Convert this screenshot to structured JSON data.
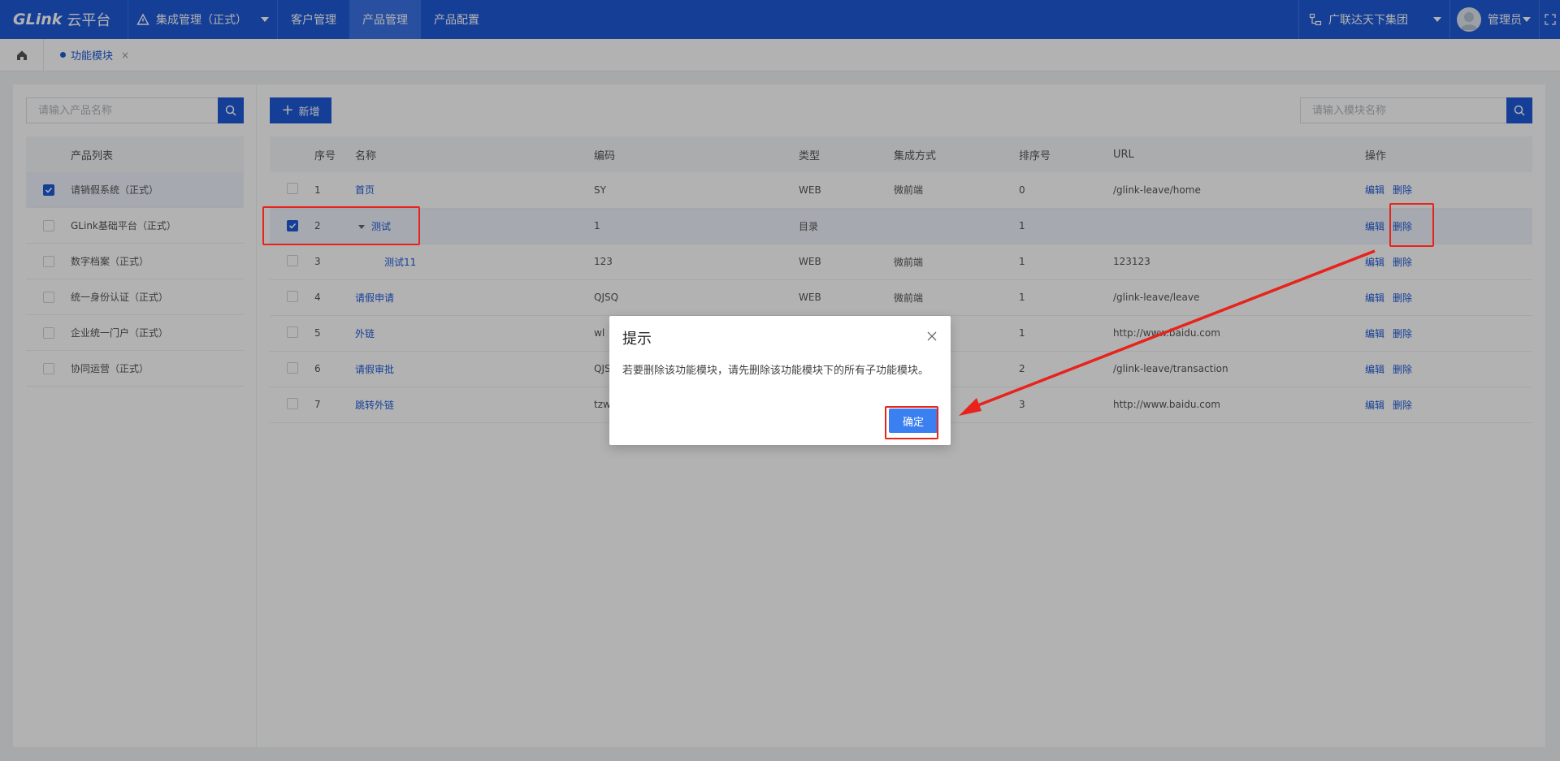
{
  "topbar": {
    "logo": "GLink",
    "logo_cn": "云平台",
    "system_select": "集成管理（正式）",
    "nav": [
      "客户管理",
      "产品管理",
      "产品配置"
    ],
    "active_nav": "产品管理",
    "org": "广联达天下集团",
    "user": "管理员"
  },
  "tabs": {
    "active_tab": "功能模块",
    "close": "×"
  },
  "left": {
    "search_placeholder": "请输入产品名称",
    "list_header": "产品列表",
    "products": [
      {
        "name": "请销假系统（正式）",
        "selected": true
      },
      {
        "name": "GLink基础平台（正式）",
        "selected": false
      },
      {
        "name": "数字档案（正式）",
        "selected": false
      },
      {
        "name": "统一身份认证（正式）",
        "selected": false
      },
      {
        "name": "企业统一门户（正式）",
        "selected": false
      },
      {
        "name": "协同运营（正式）",
        "selected": false
      }
    ]
  },
  "right": {
    "add_label": "新增",
    "search_placeholder": "请输入模块名称",
    "columns": [
      "序号",
      "名称",
      "编码",
      "类型",
      "集成方式",
      "排序号",
      "URL",
      "操作"
    ],
    "rows": [
      {
        "no": "1",
        "name": "首页",
        "code": "SY",
        "type": "WEB",
        "mode": "微前端",
        "order": "0",
        "url": "/glink-leave/home",
        "checked": false
      },
      {
        "no": "2",
        "name": "测试",
        "code": "1",
        "type": "目录",
        "mode": "",
        "order": "1",
        "url": "",
        "checked": true
      },
      {
        "no": "3",
        "name": "测试11",
        "code": "123",
        "type": "WEB",
        "mode": "微前端",
        "order": "1",
        "url": "123123",
        "checked": false
      },
      {
        "no": "4",
        "name": "请假申请",
        "code": "QJSQ",
        "type": "WEB",
        "mode": "微前端",
        "order": "1",
        "url": "/glink-leave/leave",
        "checked": false
      },
      {
        "no": "5",
        "name": "外链",
        "code": "wl",
        "type": "",
        "mode": "",
        "order": "1",
        "url": "http://www.baidu.com",
        "checked": false
      },
      {
        "no": "6",
        "name": "请假审批",
        "code": "QJS",
        "type": "",
        "mode": "",
        "order": "2",
        "url": "/glink-leave/transaction",
        "checked": false
      },
      {
        "no": "7",
        "name": "跳转外链",
        "code": "tzw",
        "type": "",
        "mode": "",
        "order": "3",
        "url": "http://www.baidu.com",
        "checked": false
      }
    ],
    "edit_label": "编辑",
    "delete_label": "删除"
  },
  "dialog": {
    "title": "提示",
    "message": "若要删除该功能模块，请先删除该功能模块下的所有子功能模块。",
    "ok_label": "确定"
  },
  "colors": {
    "primary": "#1f5bd8",
    "annotation": "#e8231b"
  }
}
